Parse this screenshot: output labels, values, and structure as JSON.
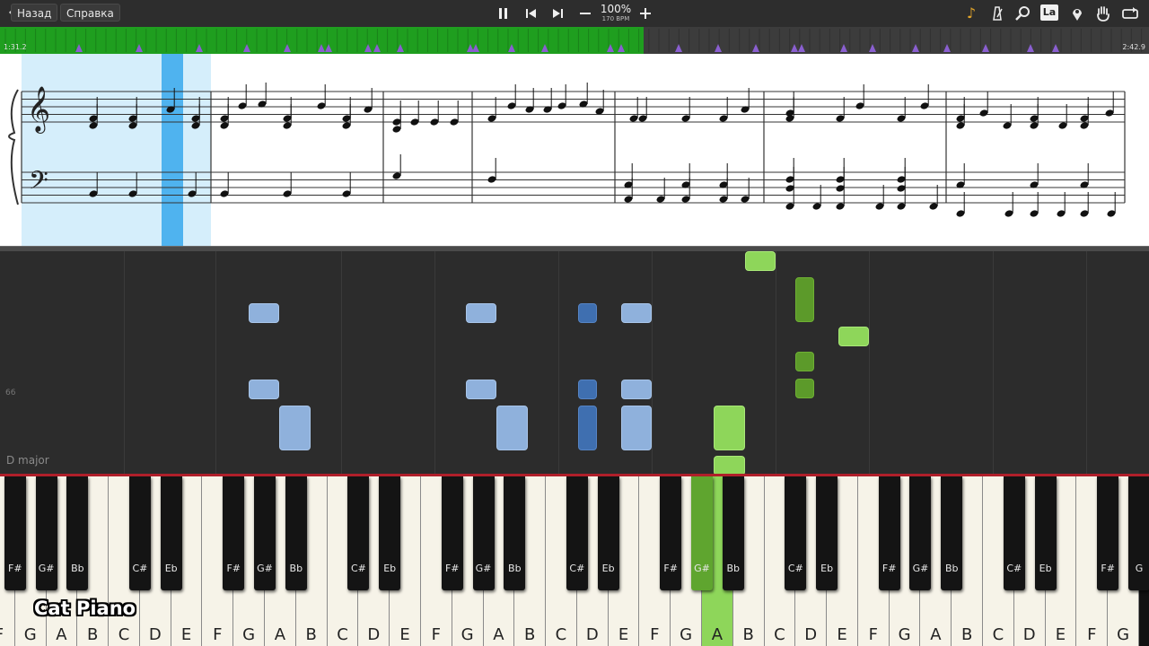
{
  "toolbar": {
    "back_label": "Назад",
    "help_label": "Справка",
    "tempo_percent": "100%",
    "tempo_bpm": "170 BPM"
  },
  "timeline": {
    "start_time": "1:31.2",
    "end_time": "2:42.9",
    "progress_fraction": 0.56
  },
  "piano_roll": {
    "marker": "66",
    "key_signature": "D major"
  },
  "keyboard": {
    "white_keys": [
      "F",
      "G",
      "A",
      "B",
      "C",
      "D",
      "E",
      "F",
      "G",
      "A",
      "B",
      "C",
      "D",
      "E",
      "F",
      "G",
      "A",
      "B",
      "C",
      "D",
      "E",
      "F",
      "G",
      "A",
      "B",
      "C",
      "D",
      "E",
      "F",
      "G",
      "A",
      "B",
      "C",
      "D",
      "E",
      "F",
      "G"
    ],
    "black_keys": [
      "F#",
      "G#",
      "Bb",
      "C#",
      "Eb",
      "F#",
      "G#",
      "Bb",
      "C#",
      "Eb",
      "F#",
      "G#",
      "Bb",
      "C#",
      "Eb",
      "F#",
      "G#",
      "Bb",
      "C#",
      "Eb",
      "F#",
      "G#",
      "Bb",
      "C#",
      "Eb",
      "F#",
      "G"
    ],
    "active_white_index": 23
  },
  "logo": "Cat Piano",
  "colors": {
    "progress_green": "#1f9e1f",
    "note_blue": "#8fb1dc",
    "note_green": "#8ed65a",
    "cursor_blue": "#4fb3ef"
  }
}
